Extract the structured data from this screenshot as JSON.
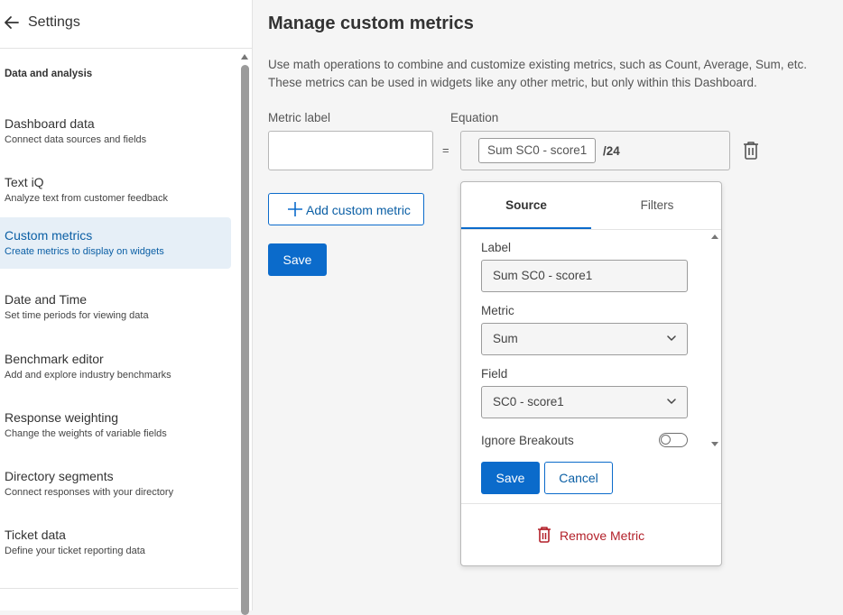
{
  "sidebar": {
    "title": "Settings",
    "section_heading": "Data and analysis",
    "items": [
      {
        "title": "Dashboard data",
        "subtitle": "Connect data sources and fields"
      },
      {
        "title": "Text iQ",
        "subtitle": "Analyze text from customer feedback"
      },
      {
        "title": "Custom metrics",
        "subtitle": "Create metrics to display on widgets",
        "active": true
      },
      {
        "title": "Date and Time",
        "subtitle": "Set time periods for viewing data"
      },
      {
        "title": "Benchmark editor",
        "subtitle": "Add and explore industry benchmarks"
      },
      {
        "title": "Response weighting",
        "subtitle": "Change the weights of variable fields"
      },
      {
        "title": "Directory segments",
        "subtitle": "Connect responses with your directory"
      },
      {
        "title": "Ticket data",
        "subtitle": "Define your ticket reporting data"
      }
    ]
  },
  "main": {
    "title": "Manage custom metrics",
    "description": "Use math operations to combine and customize existing metrics, such as Count, Average, Sum, etc. These metrics can be used in widgets like any other metric, but only within this Dashboard.",
    "metric_label_heading": "Metric label",
    "metric_label_value": "",
    "equals_sign": "=",
    "equation_heading": "Equation",
    "equation_chip": "Sum SC0 - score1",
    "equation_suffix": "/24",
    "add_metric_label": "Add custom metric",
    "save_label": "Save"
  },
  "popover": {
    "tabs": [
      "Source",
      "Filters"
    ],
    "active_tab": "Source",
    "label_heading": "Label",
    "label_value": "Sum SC0 - score1",
    "metric_heading": "Metric",
    "metric_value": "Sum",
    "field_heading": "Field",
    "field_value": "SC0 - score1",
    "ignore_breakouts_label": "Ignore Breakouts",
    "ignore_breakouts_on": false,
    "save_label": "Save",
    "cancel_label": "Cancel",
    "remove_label": "Remove Metric"
  },
  "icons": {
    "back": "arrow-left-icon",
    "trash": "trash-icon",
    "plus": "plus-icon",
    "chevron": "chevron-down-icon"
  },
  "colors": {
    "accent": "#0b6bcb",
    "danger": "#b3212a",
    "active_nav_bg": "#e6eff7"
  }
}
